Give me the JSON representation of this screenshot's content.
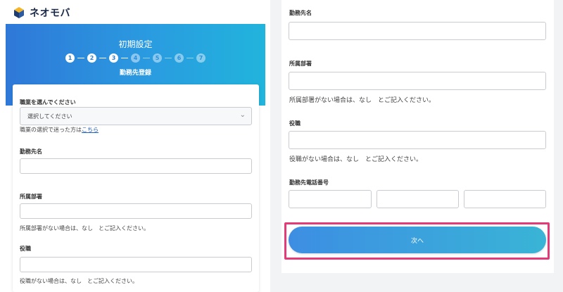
{
  "brand": {
    "name": "ネオモバ"
  },
  "header": {
    "title": "初期設定",
    "step_caption": "勤務先登録"
  },
  "steps": [
    {
      "num": "1",
      "state": "done"
    },
    {
      "num": "2",
      "state": "done"
    },
    {
      "num": "3",
      "state": "done"
    },
    {
      "num": "4",
      "state": "todo"
    },
    {
      "num": "5",
      "state": "todo"
    },
    {
      "num": "6",
      "state": "todo"
    },
    {
      "num": "7",
      "state": "todo"
    }
  ],
  "left_form": {
    "occupation_label": "職業を選んでください",
    "occupation_value": "選択してください",
    "occupation_help_prefix": "職業の選択で迷った方は",
    "occupation_help_link": "こちら",
    "employer_label": "勤務先名",
    "department_label": "所属部署",
    "department_help": "所属部署がない場合は、なし　とご記入ください。",
    "position_label": "役職",
    "position_help": "役職がない場合は、なし　とご記入ください。"
  },
  "right_form": {
    "employer_label": "勤務先名",
    "department_label": "所属部署",
    "department_help": "所属部署がない場合は、なし　とご記入ください。",
    "position_label": "役職",
    "position_help": "役職がない場合は、なし　とご記入ください。",
    "phone_label": "勤務先電話番号",
    "next_label": "次へ"
  },
  "colors": {
    "hero_start": "#2f78d8",
    "hero_end": "#21b4dc",
    "button_start": "#3d8ee3",
    "button_end": "#39b4d6",
    "highlight": "#e33a78",
    "link": "#1f5fb7"
  },
  "icons": {
    "logo": "cube-logo-icon",
    "select_arrow": "chevron-down-icon"
  }
}
